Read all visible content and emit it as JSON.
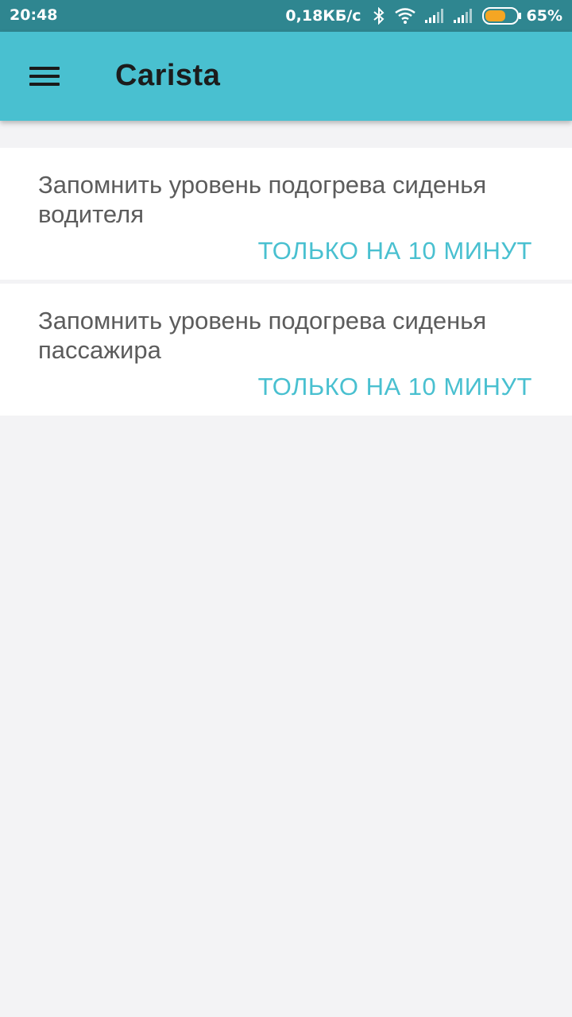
{
  "status_bar": {
    "time": "20:48",
    "net_speed": "0,18КБ/с",
    "battery_percent": "65%",
    "battery_level": 0.65,
    "battery_color": "#f5a623",
    "icons": [
      "bluetooth-icon",
      "wifi-icon",
      "signal-icon",
      "signal-icon",
      "battery-icon"
    ]
  },
  "app_bar": {
    "title": "Carista",
    "menu_icon": "hamburger-menu-icon",
    "color": "#49c0d0"
  },
  "settings": [
    {
      "label": "Запомнить уровень подогрева сиденья водителя",
      "value": "ТОЛЬКО НА 10 МИНУТ"
    },
    {
      "label": "Запомнить уровень подогрева сиденья пассажира",
      "value": "ТОЛЬКО НА 10 МИНУТ"
    }
  ],
  "colors": {
    "accent": "#49c0d0",
    "status_bar": "#2f8690",
    "background": "#f3f3f5"
  }
}
